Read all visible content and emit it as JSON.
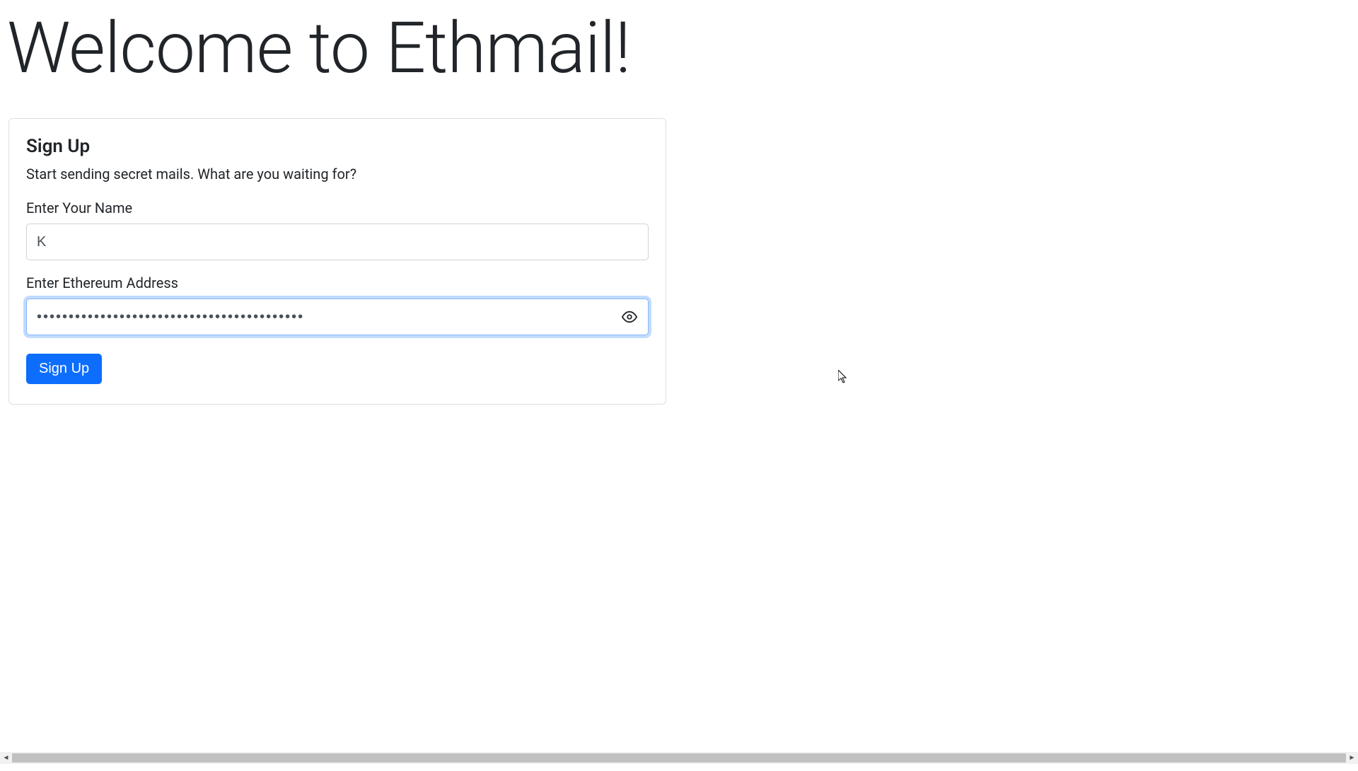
{
  "page": {
    "title": "Welcome to Ethmail!"
  },
  "card": {
    "title": "Sign Up",
    "subtitle": "Start sending secret mails. What are you waiting for?",
    "name_label": "Enter Your Name",
    "name_value": "K",
    "address_label": "Enter Ethereum Address",
    "address_masked": "••••••••••••••••••••••••••••••••••••••••••",
    "signup_button": "Sign Up"
  }
}
